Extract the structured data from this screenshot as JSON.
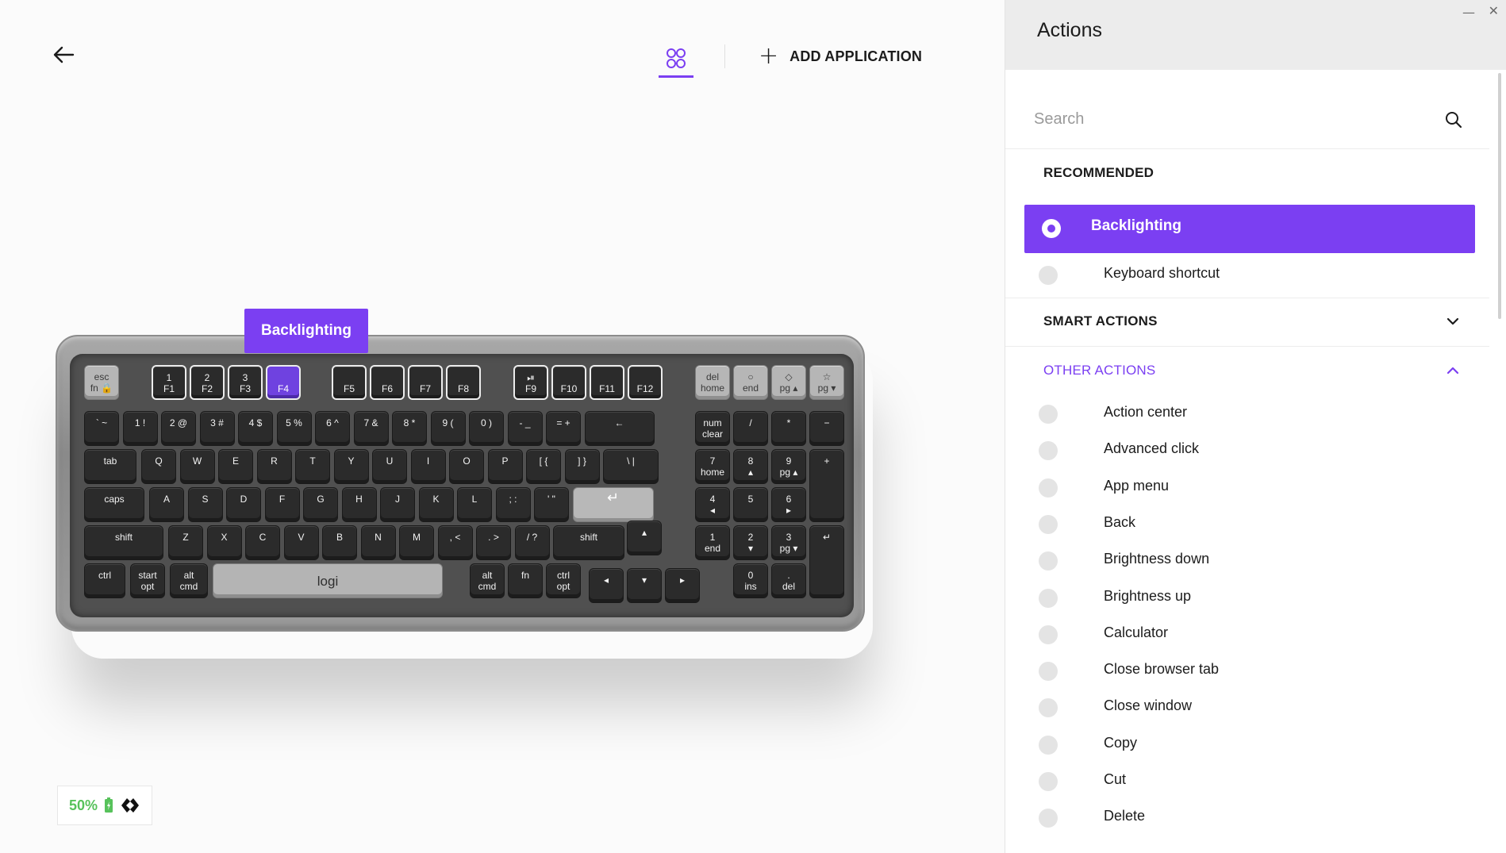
{
  "toolbar": {
    "add_application_label": "ADD APPLICATION"
  },
  "tooltip": {
    "label": "Backlighting"
  },
  "keyboard": {
    "brand": "logi",
    "row_fn": [
      "esc\nfn 🔒",
      "1\nF1",
      "2\nF2",
      "3\nF3",
      "\nF4",
      "\nF5",
      "\nF6",
      "\nF7",
      "\nF8",
      "⏯\nF9",
      "\nF10",
      "\nF11",
      "\nF12",
      "del\nhome",
      "○\nend",
      "◇\npg ▴",
      "☆\npg ▾"
    ],
    "row_num": [
      "` ~",
      "1 !",
      "2 @",
      "3 #",
      "4 $",
      "5 %",
      "6 ^",
      "7 &",
      "8 *",
      "9 (",
      "0 )",
      "- _",
      "= +",
      "←",
      "num\nclear",
      "/",
      "*",
      "−"
    ],
    "row_q": [
      "tab",
      "Q",
      "W",
      "E",
      "R",
      "T",
      "Y",
      "U",
      "I",
      "O",
      "P",
      "[ {",
      "] }",
      "\\ |",
      "7\nhome",
      "8\n▴",
      "9\npg ▴",
      "+"
    ],
    "row_a": [
      "caps",
      "A",
      "S",
      "D",
      "F",
      "G",
      "H",
      "J",
      "K",
      "L",
      "; :",
      "' \"",
      "↵",
      "4\n◂",
      "5",
      "6\n▸"
    ],
    "row_z": [
      "shift",
      "Z",
      "X",
      "C",
      "V",
      "B",
      "N",
      "M",
      ", <",
      ". >",
      "/ ?",
      "shift",
      "▴",
      "1\nend",
      "2\n▾",
      "3\npg ▾",
      "↵"
    ],
    "row_ctrl": [
      "ctrl",
      "start\nopt",
      "alt\ncmd",
      "logi",
      "alt\ncmd",
      "fn",
      "ctrl\nopt",
      "◂",
      "▾",
      "▸",
      "0\nins",
      ".\ndel"
    ]
  },
  "battery": {
    "percent": "50%"
  },
  "panel": {
    "title": "Actions",
    "search_placeholder": "Search",
    "recommended_header": "RECOMMENDED",
    "recommended": [
      {
        "label": "Backlighting",
        "selected": true
      },
      {
        "label": "Keyboard shortcut",
        "selected": false
      }
    ],
    "smart_actions_header": "SMART ACTIONS",
    "other_actions_header": "OTHER ACTIONS",
    "other_actions": [
      "Action center",
      "Advanced click",
      "App menu",
      "Back",
      "Brightness down",
      "Brightness up",
      "Calculator",
      "Close browser tab",
      "Close window",
      "Copy",
      "Cut",
      "Delete"
    ]
  },
  "colors": {
    "accent": "#7b3ff2",
    "battery": "#57c25b",
    "header_bg": "#ececec"
  },
  "icons": {
    "back": "arrow-left-icon",
    "app_grid": "four-circles-icon",
    "add": "plus-icon",
    "search": "magnifier-icon",
    "expand": "chevron-down-icon",
    "collapse": "chevron-up-icon",
    "battery": "battery-icon",
    "receiver": "logi-bolt-icon"
  }
}
